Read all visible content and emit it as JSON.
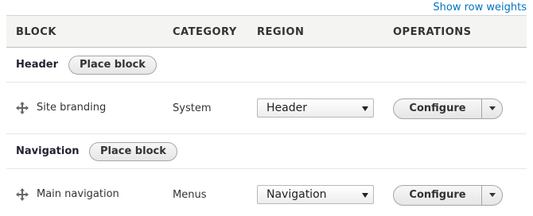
{
  "toolbar": {
    "row_weights_label": "Show row weights"
  },
  "table": {
    "headers": {
      "block": "BLOCK",
      "category": "CATEGORY",
      "region": "REGION",
      "operations": "OPERATIONS"
    },
    "regions": [
      {
        "title": "Header",
        "place_label": "Place block",
        "blocks": [
          {
            "name": "Site branding",
            "category": "System",
            "region_value": "Header",
            "configure_label": "Configure"
          }
        ]
      },
      {
        "title": "Navigation",
        "place_label": "Place block",
        "blocks": [
          {
            "name": "Main navigation",
            "category": "Menus",
            "region_value": "Navigation",
            "configure_label": "Configure"
          }
        ]
      }
    ]
  },
  "icons": {
    "drag": "move-arrows-icon",
    "select_arrow": "triangle-down-icon",
    "dropbutton_toggle": "triangle-down-icon"
  },
  "colors": {
    "link": "#0074bd",
    "header_bg": "#f4f4f2",
    "border": "#bfbfba"
  }
}
